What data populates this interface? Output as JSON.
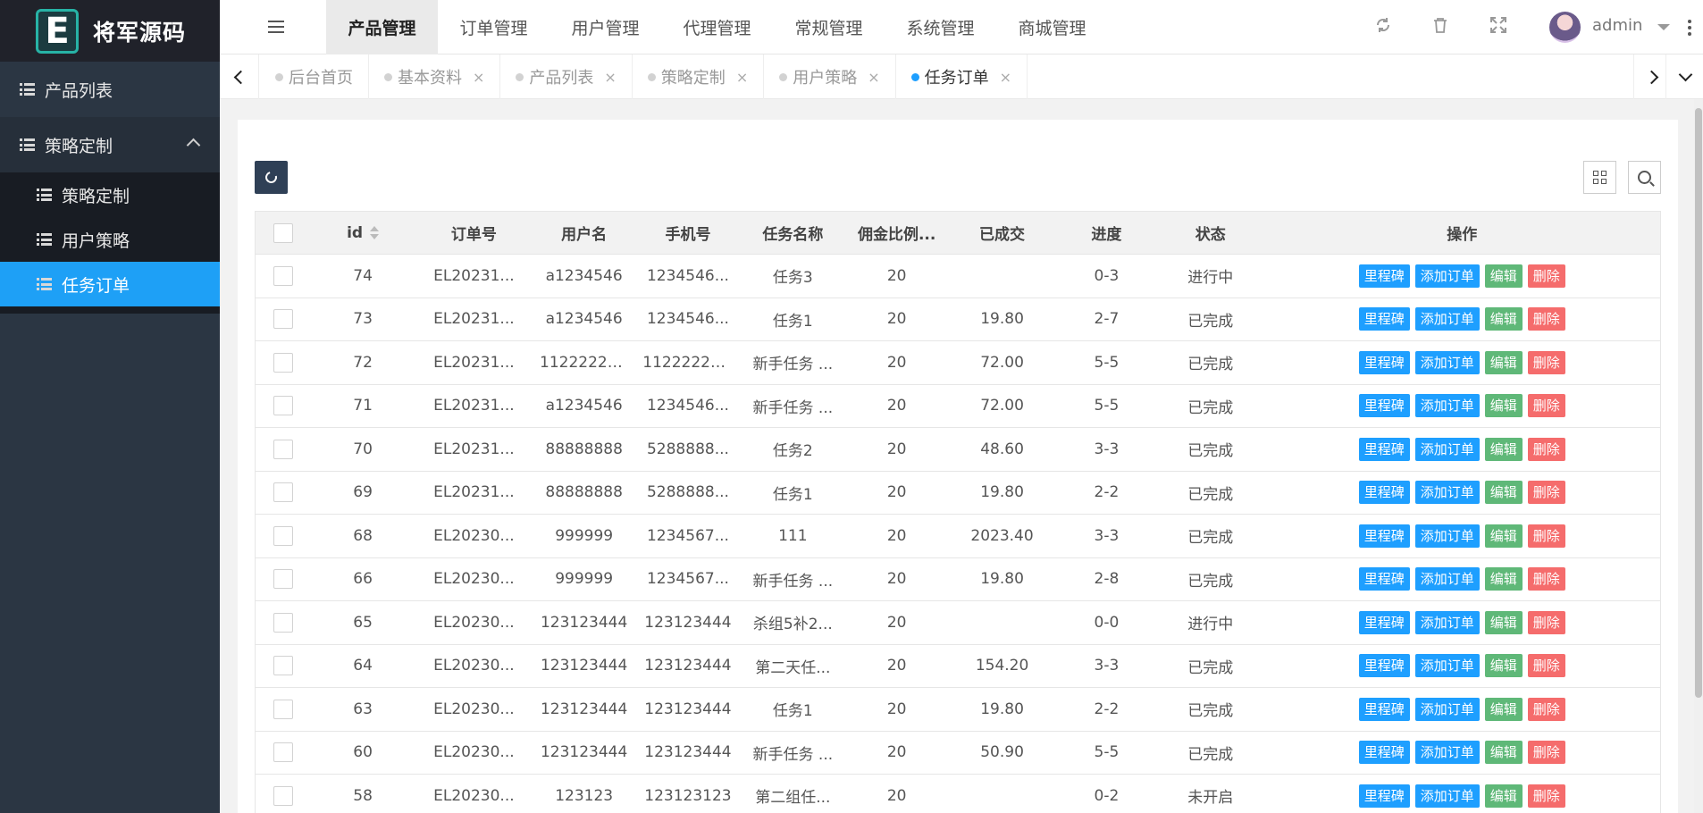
{
  "logo": {
    "letter": "E",
    "name": "将军源码"
  },
  "sidebar": {
    "items": [
      {
        "label": "产品列表",
        "icon": "list-icon"
      },
      {
        "label": "策略定制",
        "icon": "list-icon",
        "expanded": true
      }
    ],
    "sub_items": [
      {
        "label": "策略定制",
        "icon": "list-icon",
        "active": false
      },
      {
        "label": "用户策略",
        "icon": "list-icon",
        "active": false
      },
      {
        "label": "任务订单",
        "icon": "list-icon",
        "active": true
      }
    ]
  },
  "header": {
    "nav": [
      "产品管理",
      "订单管理",
      "用户管理",
      "代理管理",
      "常规管理",
      "系统管理",
      "商城管理"
    ],
    "active_nav": 0,
    "icons": [
      "refresh-icon",
      "trash-icon",
      "fullscreen-icon"
    ],
    "user": "admin"
  },
  "tabs": [
    {
      "label": "后台首页",
      "closable": false,
      "active": false
    },
    {
      "label": "基本资料",
      "closable": true,
      "active": false
    },
    {
      "label": "产品列表",
      "closable": true,
      "active": false
    },
    {
      "label": "策略定制",
      "closable": true,
      "active": false
    },
    {
      "label": "用户策略",
      "closable": true,
      "active": false
    },
    {
      "label": "任务订单",
      "closable": true,
      "active": true
    }
  ],
  "tab_close_glyph": "×",
  "table": {
    "columns": [
      "",
      "id",
      "订单号",
      "用户名",
      "手机号",
      "任务名称",
      "佣金比例...",
      "已成交",
      "进度",
      "状态",
      "操作"
    ],
    "actions": [
      "里程碑",
      "添加订单",
      "编辑",
      "删除"
    ],
    "rows": [
      [
        "74",
        "EL20231...",
        "a1234546",
        "1234546...",
        "任务3",
        "20",
        "",
        "0-3",
        "进行中"
      ],
      [
        "73",
        "EL20231...",
        "a1234546",
        "1234546...",
        "任务1",
        "20",
        "19.80",
        "2-7",
        "已完成"
      ],
      [
        "72",
        "EL20231...",
        "11222222...",
        "11222222...",
        "新手任务 ...",
        "20",
        "72.00",
        "5-5",
        "已完成"
      ],
      [
        "71",
        "EL20231...",
        "a1234546",
        "1234546...",
        "新手任务 ...",
        "20",
        "72.00",
        "5-5",
        "已完成"
      ],
      [
        "70",
        "EL20231...",
        "88888888",
        "5288888...",
        "任务2",
        "20",
        "48.60",
        "3-3",
        "已完成"
      ],
      [
        "69",
        "EL20231...",
        "88888888",
        "5288888...",
        "任务1",
        "20",
        "19.80",
        "2-2",
        "已完成"
      ],
      [
        "68",
        "EL20230...",
        "999999",
        "1234567...",
        "111",
        "20",
        "2023.40",
        "3-3",
        "已完成"
      ],
      [
        "66",
        "EL20230...",
        "999999",
        "1234567...",
        "新手任务 ...",
        "20",
        "19.80",
        "2-8",
        "已完成"
      ],
      [
        "65",
        "EL20230...",
        "123123444",
        "123123444",
        "杀组5补2...",
        "20",
        "",
        "0-0",
        "进行中"
      ],
      [
        "64",
        "EL20230...",
        "123123444",
        "123123444",
        "第二天任...",
        "20",
        "154.20",
        "3-3",
        "已完成"
      ],
      [
        "63",
        "EL20230...",
        "123123444",
        "123123444",
        "任务1",
        "20",
        "19.80",
        "2-2",
        "已完成"
      ],
      [
        "60",
        "EL20230...",
        "123123444",
        "123123444",
        "新手任务 ...",
        "20",
        "50.90",
        "5-5",
        "已完成"
      ],
      [
        "58",
        "EL20230...",
        "123123",
        "123123123",
        "第二组任...",
        "20",
        "",
        "0-2",
        "未开启"
      ]
    ]
  },
  "colors": {
    "active_blue": "#1e9fff",
    "sidebar_bg": "#2b3643",
    "edit_green": "#5fb878",
    "delete_red": "#f56c6c"
  }
}
